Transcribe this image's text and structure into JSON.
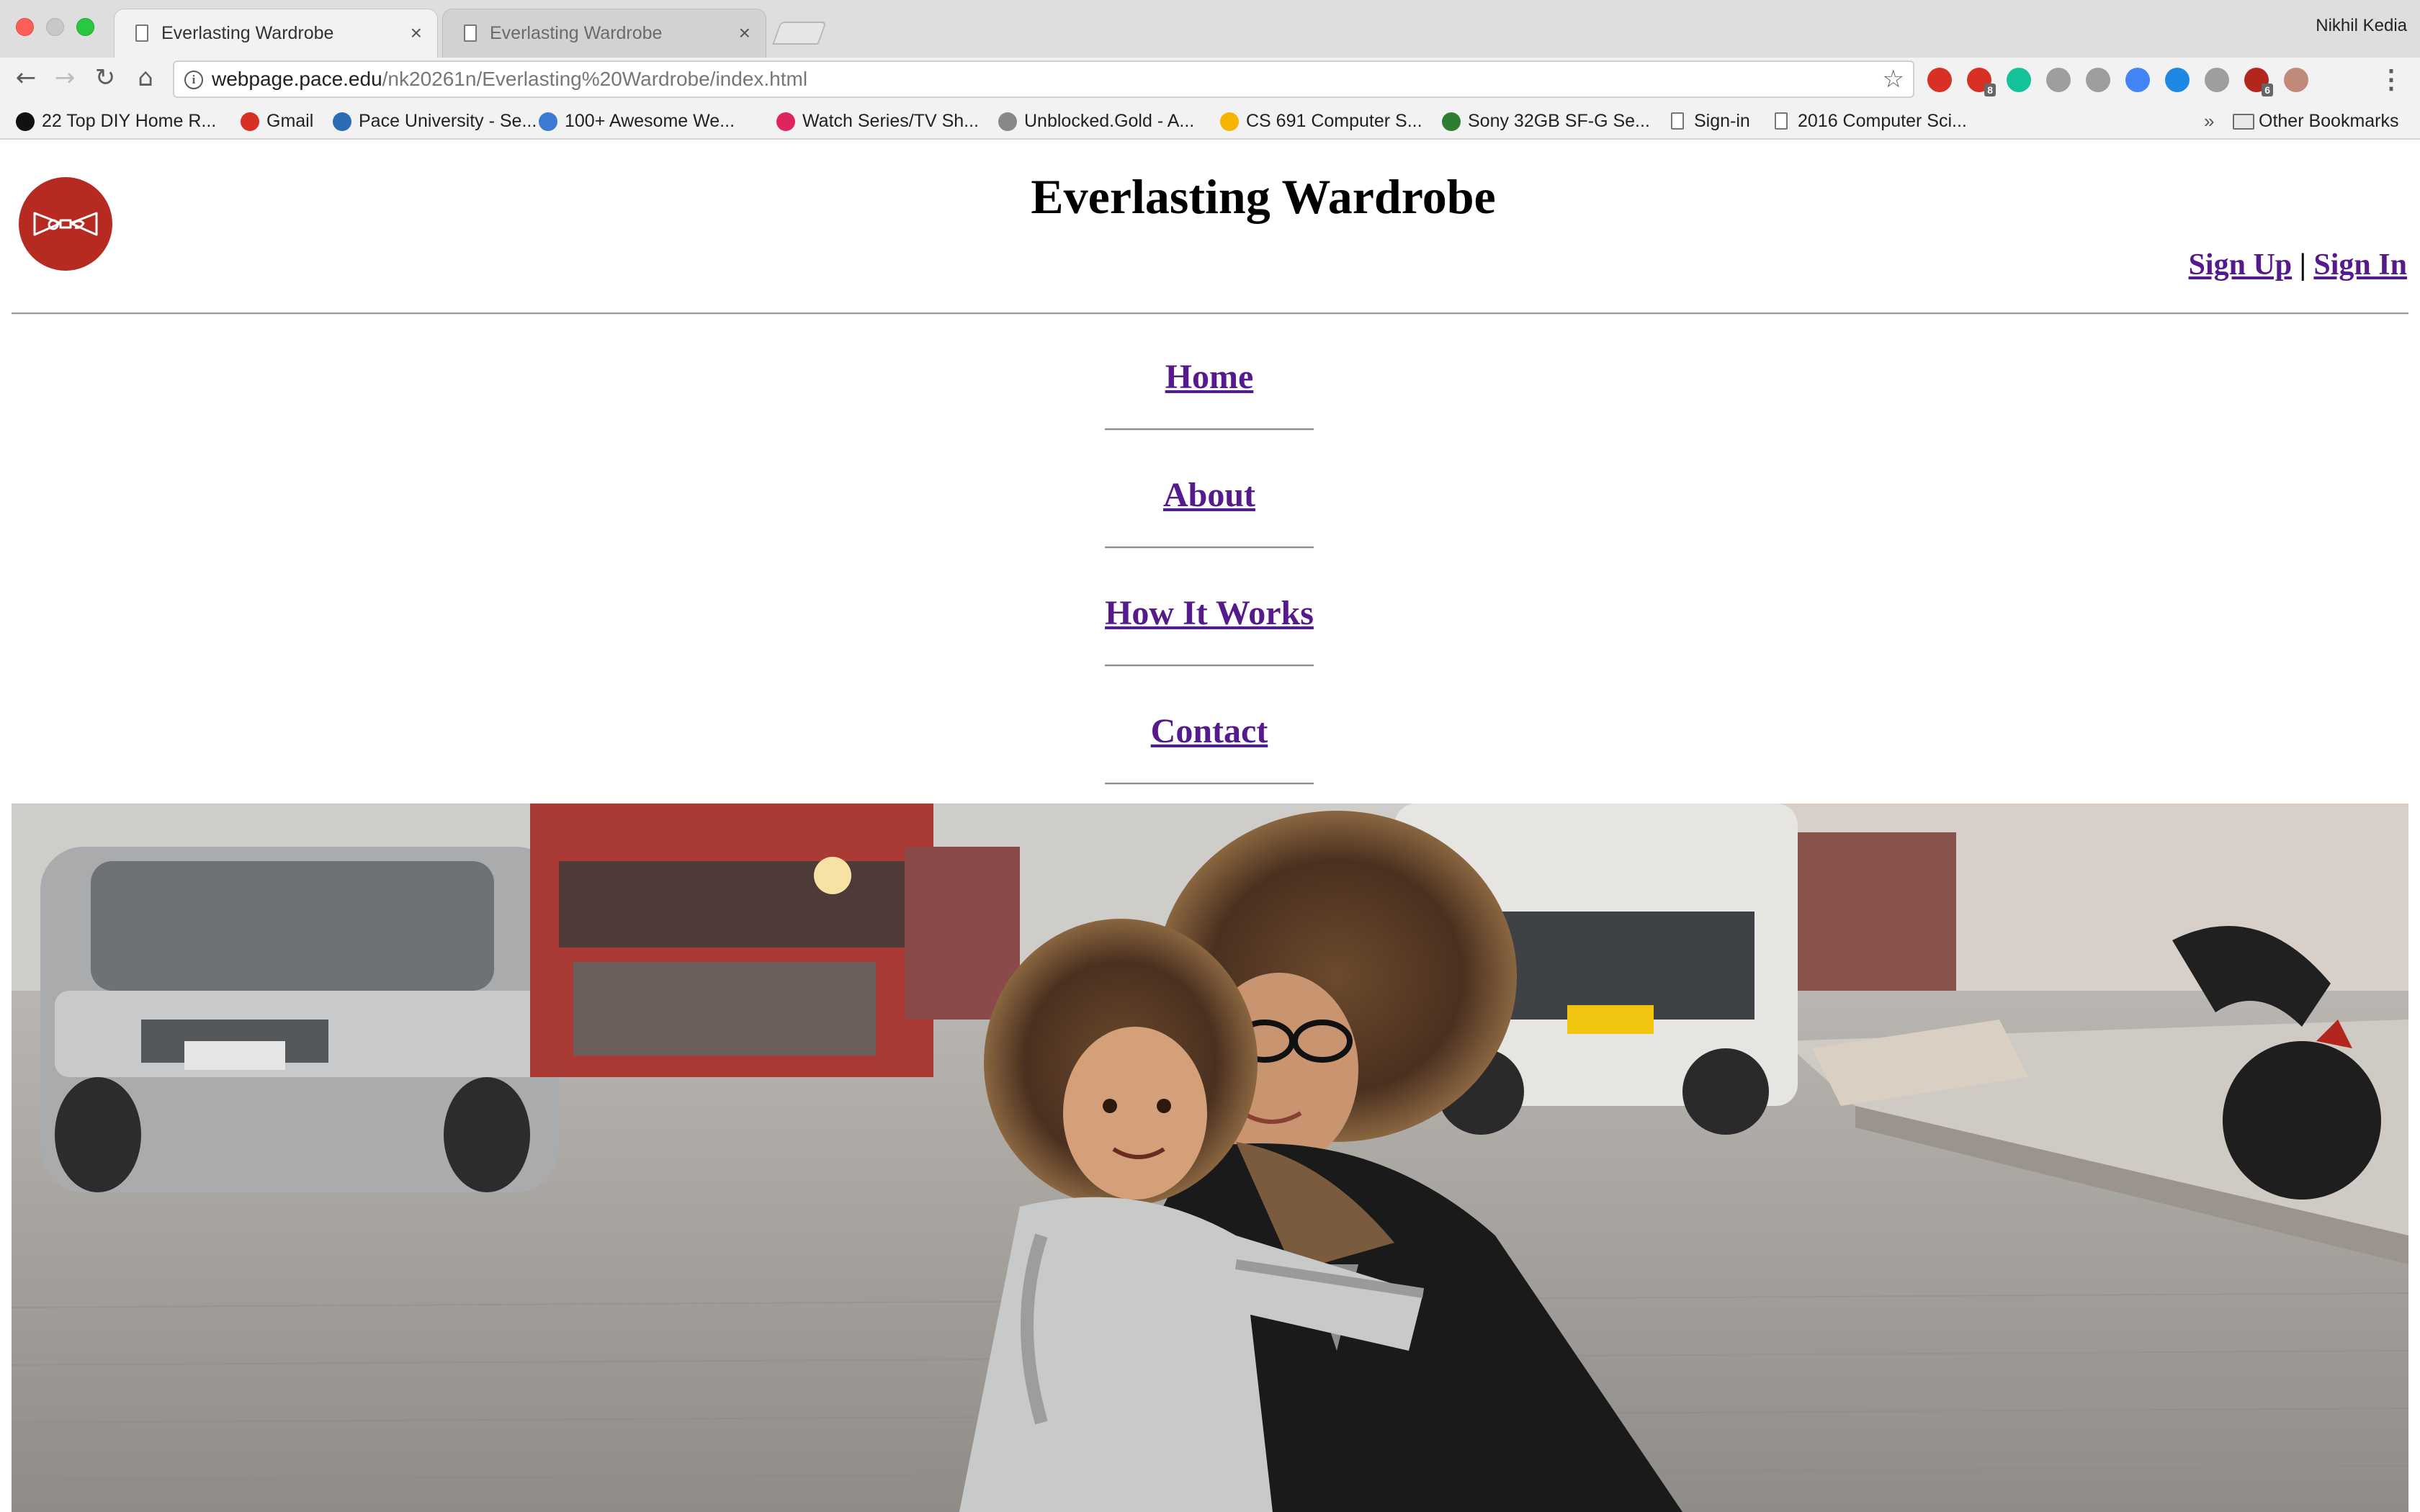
{
  "browser": {
    "tabs": [
      {
        "title": "Everlasting Wardrobe",
        "active": true
      },
      {
        "title": "Everlasting Wardrobe",
        "active": false
      }
    ],
    "profile_name": "Nikhil Kedia",
    "address": {
      "host": "webpage.pace.edu",
      "path": "/nk20261n/Everlasting%20Wardrobe/index.html"
    },
    "extensions": [
      {
        "icon": "youtube-icon",
        "color": "#d93025"
      },
      {
        "icon": "gmail-icon",
        "color": "#d93025",
        "badge": "8"
      },
      {
        "icon": "grammarly-icon",
        "color": "#15c39a"
      },
      {
        "icon": "drive-icon",
        "color": "#9e9e9e"
      },
      {
        "icon": "dropbox-icon",
        "color": "#9e9e9e"
      },
      {
        "icon": "translate-icon",
        "color": "#4285f4"
      },
      {
        "icon": "onedrive-icon",
        "color": "#1e88e5"
      },
      {
        "icon": "wordtune-icon",
        "color": "#9e9e9e"
      },
      {
        "icon": "shield-icon",
        "color": "#b3261e",
        "badge": "6"
      },
      {
        "icon": "avatar-icon",
        "color": "#c0897a"
      }
    ],
    "bookmarks": [
      {
        "label": "22 Top DIY Home R...",
        "icon": "g-icon",
        "color": "#111"
      },
      {
        "label": "Gmail",
        "icon": "gmail-icon",
        "color": "#d93025"
      },
      {
        "label": "Pace University - Se...",
        "icon": "pace-icon",
        "color": "#2a6bb3"
      },
      {
        "label": "100+ Awesome We...",
        "icon": "atom-icon",
        "color": "#3b7bd5"
      },
      {
        "label": "Watch Series/TV Sh...",
        "icon": "e-icon",
        "color": "#e0245e"
      },
      {
        "label": "Unblocked.Gold - A...",
        "icon": "lock-icon",
        "color": "#888"
      },
      {
        "label": "CS 691 Computer S...",
        "icon": "drive-icon",
        "color": "#f4b400"
      },
      {
        "label": "Sony 32GB SF-G Se...",
        "icon": "bh-icon",
        "color": "#2e7d32"
      },
      {
        "label": "Sign-in",
        "icon": "doc-icon",
        "color": "#777"
      },
      {
        "label": "2016 Computer Sci...",
        "icon": "doc-icon",
        "color": "#777"
      }
    ],
    "bookmarks_overflow": "»",
    "other_bookmarks": "Other Bookmarks"
  },
  "site": {
    "title": "Everlasting Wardrobe",
    "sign_up": "Sign Up",
    "separator": "|",
    "sign_in": "Sign In",
    "nav": [
      "Home",
      "About",
      "How It Works",
      "Contact"
    ],
    "link_color": "#551a8b",
    "logo_color": "#b72a21",
    "hero_image": "mother-and-child-street-photo"
  }
}
